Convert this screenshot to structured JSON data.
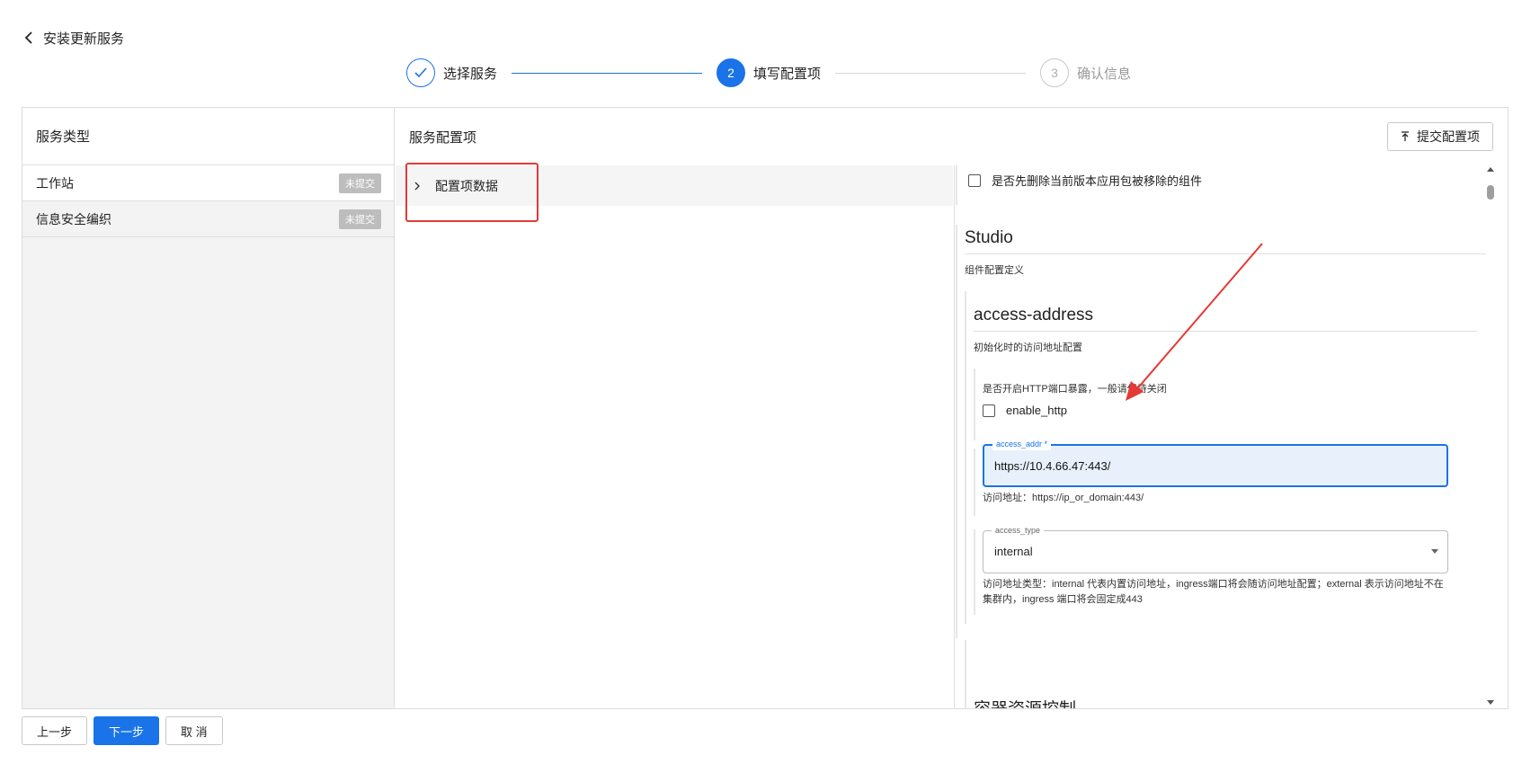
{
  "header": {
    "title": "安装更新服务",
    "back_icon": "chevron-left-icon"
  },
  "steps": [
    {
      "label": "选择服务",
      "state": "done",
      "icon": "check-icon"
    },
    {
      "label": "填写配置项",
      "state": "active",
      "number": "2"
    },
    {
      "label": "确认信息",
      "state": "pending",
      "number": "3"
    }
  ],
  "left_panel": {
    "title": "服务类型",
    "items": [
      {
        "label": "工作站",
        "badge": "未提交"
      },
      {
        "label": "信息安全编织",
        "badge": "未提交"
      }
    ]
  },
  "middle_panel": {
    "title": "服务配置项",
    "tree": [
      {
        "label": "配置项数据",
        "expanded": false
      }
    ]
  },
  "toolbar": {
    "submit_label": "提交配置项",
    "submit_icon": "upload-icon"
  },
  "config": {
    "remove_components_label": "是否先删除当前版本应用包被移除的组件",
    "studio": {
      "title": "Studio",
      "desc": "组件配置定义",
      "access_address": {
        "title": "access-address",
        "desc": "初始化时的访问地址配置",
        "http_desc": "是否开启HTTP端口暴露，一般请保持关闭",
        "enable_http_label": "enable_http",
        "access_addr_label": "access_addr *",
        "access_addr_value": "https://10.4.66.47:443/",
        "access_addr_help": "访问地址：https://ip_or_domain:443/",
        "access_type_label": "access_type",
        "access_type_value": "internal",
        "access_type_help": "访问地址类型：internal 代表内置访问地址，ingress端口将会随访问地址配置；external 表示访问地址不在集群内，ingress 端口将会固定成443"
      }
    },
    "next_section_title": "容器资源控制"
  },
  "footer": {
    "prev_label": "上一步",
    "next_label": "下一步",
    "cancel_label": "取 消"
  },
  "colors": {
    "accent": "#1a73e8",
    "annotation_red": "#e53935",
    "badge_gray": "#bdbdbd"
  }
}
